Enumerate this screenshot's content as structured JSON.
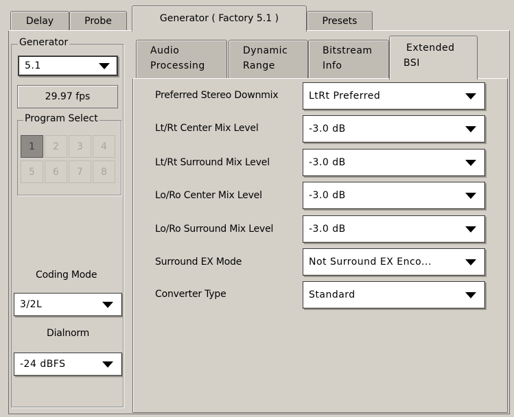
{
  "top_tabs": [
    {
      "label": "Delay",
      "active": false
    },
    {
      "label": "Probe",
      "active": false
    },
    {
      "label": "Generator ( Factory 5.1 )",
      "active": true
    },
    {
      "label": "Presets",
      "active": false
    }
  ],
  "sidebar": {
    "generator_title": "Generator",
    "generator_value": "5.1",
    "fps": "29.97 fps",
    "program_select_title": "Program Select",
    "programs": [
      "1",
      "2",
      "3",
      "4",
      "5",
      "6",
      "7",
      "8"
    ],
    "selected_program": "1",
    "coding_mode_label": "Coding Mode",
    "coding_mode_value": "3/2L",
    "dialnorm_label": "Dialnorm",
    "dialnorm_value": "-24 dBFS"
  },
  "sub_tabs": [
    {
      "line1": "Audio",
      "line2": "Processing",
      "active": false
    },
    {
      "line1": "Dynamic",
      "line2": "Range",
      "active": false
    },
    {
      "line1": "Bitstream",
      "line2": "Info",
      "active": false
    },
    {
      "line1": "Extended",
      "line2": "BSI",
      "active": true
    }
  ],
  "settings": [
    {
      "label": "Preferred Stereo Downmix",
      "value": "LtRt Preferred"
    },
    {
      "label": "Lt/Rt Center Mix Level",
      "value": "-3.0 dB"
    },
    {
      "label": "Lt/Rt Surround Mix Level",
      "value": "-3.0 dB"
    },
    {
      "label": "Lo/Ro Center Mix Level",
      "value": "-3.0 dB"
    },
    {
      "label": "Lo/Ro Surround Mix Level",
      "value": "-3.0 dB"
    },
    {
      "label": "Surround EX Mode",
      "value": "Not Surround EX Enco..."
    },
    {
      "label": "Converter Type",
      "value": "Standard"
    }
  ],
  "colors": {
    "background": "#d4d0c8",
    "tab_inactive": "#c0bcb4",
    "selected_program": "#8e8b86"
  }
}
